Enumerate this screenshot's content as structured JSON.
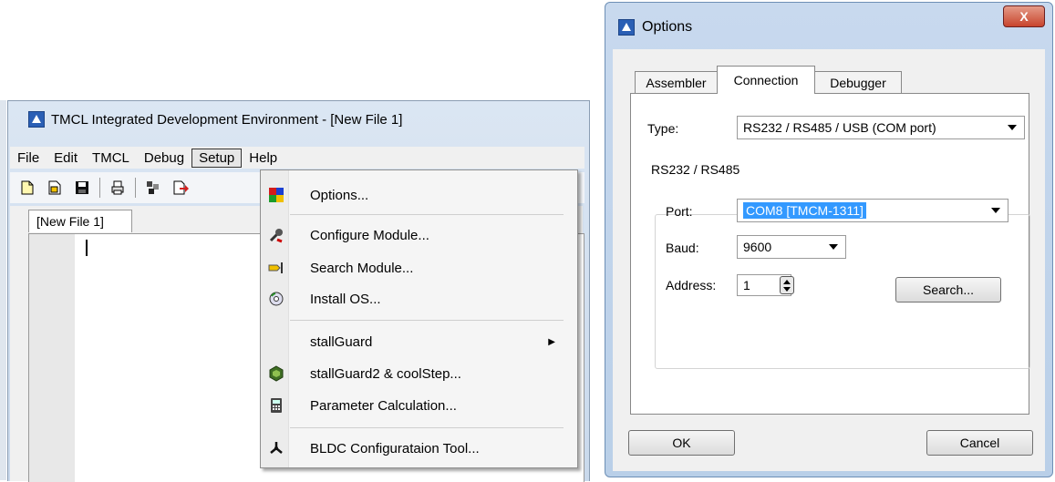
{
  "ide": {
    "title": "TMCL Integrated Development Environment - [New File 1]",
    "menu": [
      "File",
      "Edit",
      "TMCL",
      "Debug",
      "Setup",
      "Help"
    ],
    "active_menu": "Setup",
    "doc_tab": "[New File 1]"
  },
  "setup_menu": {
    "items": [
      {
        "label": "Options...",
        "icon": "options-icon"
      },
      {
        "label": "Configure Module...",
        "icon": "configure-module-icon"
      },
      {
        "label": "Search Module...",
        "icon": "search-module-icon"
      },
      {
        "label": "Install OS...",
        "icon": "install-os-icon"
      },
      {
        "label": "stallGuard",
        "icon": "",
        "submenu": true
      },
      {
        "label": "stallGuard2 & coolStep...",
        "icon": "coolstep-icon"
      },
      {
        "label": "Parameter Calculation...",
        "icon": "calculator-icon"
      },
      {
        "label": "BLDC Configurataion Tool...",
        "icon": "bldc-icon"
      }
    ]
  },
  "dialog": {
    "title": "Options",
    "close_label": "X",
    "tabs": [
      "Assembler",
      "Connection",
      "Debugger"
    ],
    "active_tab": "Connection",
    "type_label": "Type:",
    "type_value": "RS232 / RS485 / USB (COM port)",
    "group_label": "RS232 / RS485",
    "port_label": "Port:",
    "port_value": "COM8 [TMCM-1311]",
    "baud_label": "Baud:",
    "baud_value": "9600",
    "address_label": "Address:",
    "address_value": "1",
    "search_label": "Search...",
    "ok_label": "OK",
    "cancel_label": "Cancel"
  }
}
